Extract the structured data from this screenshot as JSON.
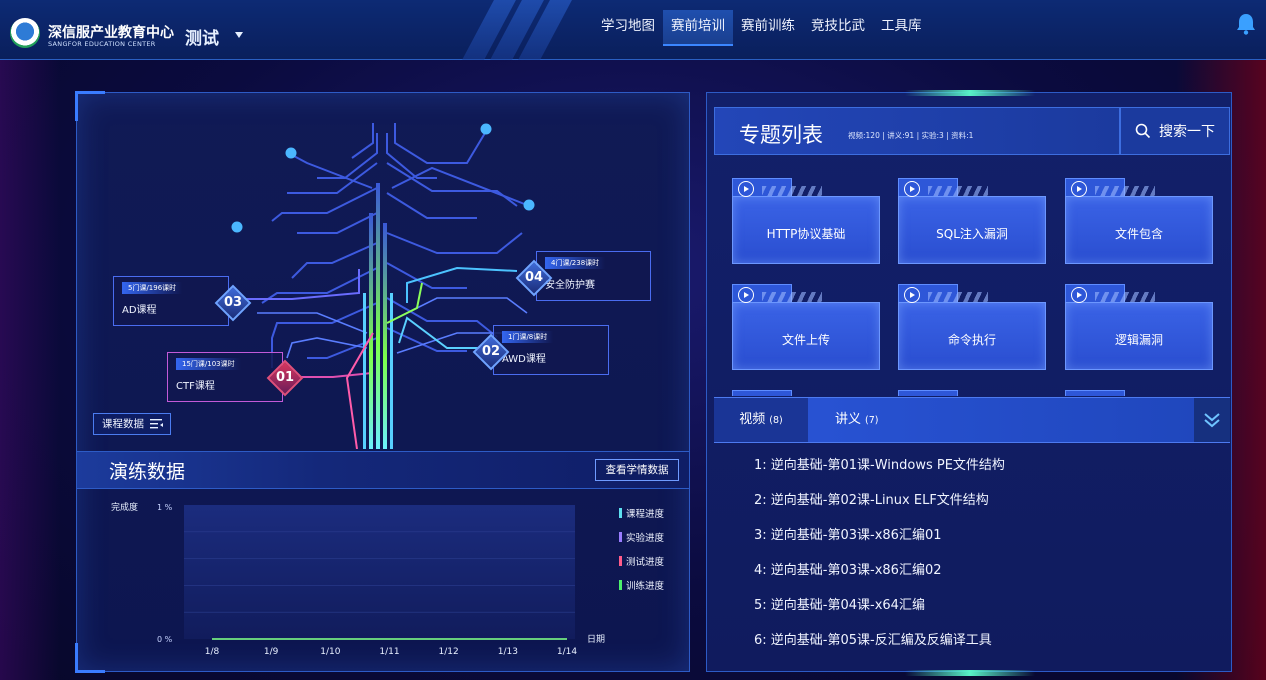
{
  "header": {
    "brand_cn": "深信服产业教育中心",
    "brand_en": "SANGFOR EDUCATION CENTER",
    "user": "测试",
    "nav": [
      {
        "label": "学习地图",
        "active": false
      },
      {
        "label": "赛前培训",
        "active": true
      },
      {
        "label": "赛前训练",
        "active": false
      },
      {
        "label": "竞技比武",
        "active": false
      },
      {
        "label": "工具库",
        "active": false
      }
    ]
  },
  "tree": {
    "courses": [
      {
        "num": "01",
        "badge": "15门课/103课时",
        "name": "CTF课程"
      },
      {
        "num": "02",
        "badge": "1门课/8课时",
        "name": "AWD课程"
      },
      {
        "num": "03",
        "badge": "5门课/196课时",
        "name": "AD课程"
      },
      {
        "num": "04",
        "badge": "4门课/238课时",
        "name": "安全防护赛"
      }
    ],
    "course_data_label": "课程数据"
  },
  "drill": {
    "title": "演练数据",
    "view_button": "查看学情数据",
    "chart": {
      "ylabel": "完成度",
      "y_top_label": "1 %",
      "y_bottom_label": "0 %",
      "xlabel": "日期",
      "x_ticks": [
        "1/8",
        "1/9",
        "1/10",
        "1/11",
        "1/12",
        "1/13",
        "1/14"
      ],
      "legend": [
        {
          "name": "课程进度",
          "color": "#5ee0f0"
        },
        {
          "name": "实验进度",
          "color": "#9a7cff"
        },
        {
          "name": "测试进度",
          "color": "#ff5c8a"
        },
        {
          "name": "训练进度",
          "color": "#4cf06c"
        }
      ]
    }
  },
  "chart_data": {
    "type": "line",
    "x": [
      "1/8",
      "1/9",
      "1/10",
      "1/11",
      "1/12",
      "1/13",
      "1/14"
    ],
    "ylabel": "完成度",
    "xlabel": "日期",
    "ylim": [
      0,
      1
    ],
    "series": [
      {
        "name": "课程进度",
        "values": [
          0,
          0,
          0,
          0,
          0,
          0,
          0
        ]
      },
      {
        "name": "实验进度",
        "values": [
          0,
          0,
          0,
          0,
          0,
          0,
          0
        ]
      },
      {
        "name": "测试进度",
        "values": [
          0,
          0,
          0,
          0,
          0,
          0,
          0
        ]
      },
      {
        "name": "训练进度",
        "values": [
          0,
          0,
          0,
          0,
          0,
          0,
          0
        ]
      }
    ],
    "legend_position": "right"
  },
  "topics": {
    "title": "专题列表",
    "stats": "视频:120 | 讲义:91 | 实验:3 | 资料:1",
    "search_label": "搜索一下",
    "cards": [
      "HTTP协议基础",
      "SQL注入漏洞",
      "文件包含",
      "文件上传",
      "命令执行",
      "逻辑漏洞"
    ]
  },
  "tabs": [
    {
      "label": "视频",
      "count": "(8)"
    },
    {
      "label": "讲义",
      "count": "(7)"
    }
  ],
  "lessons": [
    "1: 逆向基础-第01课-Windows PE文件结构",
    "2: 逆向基础-第02课-Linux ELF文件结构",
    "3: 逆向基础-第03课-x86汇编01",
    "4: 逆向基础-第03课-x86汇编02",
    "5: 逆向基础-第04课-x64汇编",
    "6: 逆向基础-第05课-反汇编及反编译工具"
  ],
  "colors": {
    "accent": "#3b86ff",
    "card": "#3a63e6",
    "glow": "#58f0c6"
  }
}
